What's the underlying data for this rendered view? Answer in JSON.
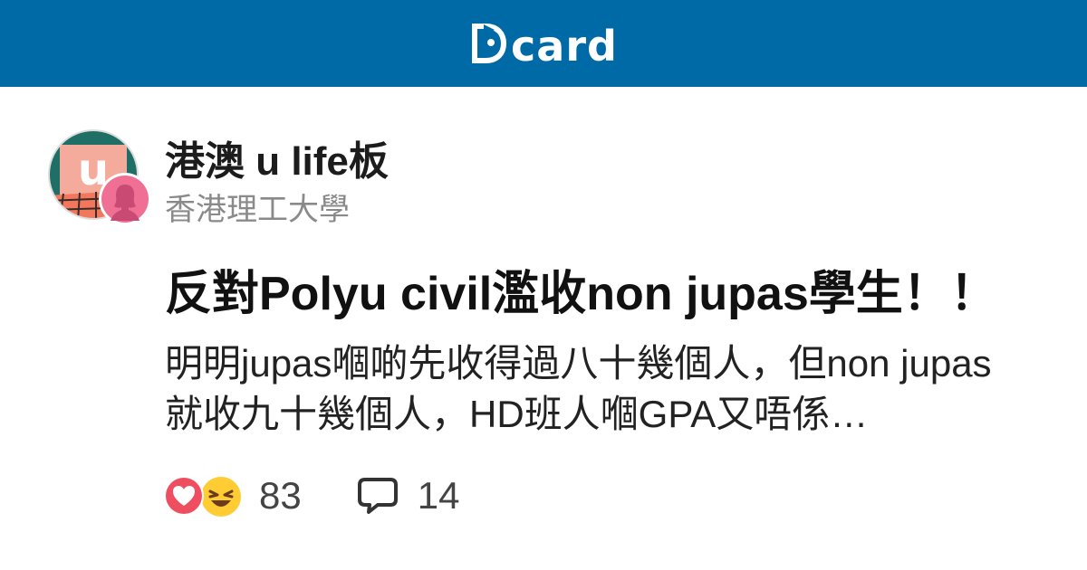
{
  "header": {
    "logo_text": "card",
    "background_color": "#006aa6"
  },
  "board": {
    "name": "港澳 u life板",
    "avatar_letter": "u",
    "avatar_icon": "board-avatar-icon"
  },
  "author": {
    "school": "香港理工大學",
    "avatar_icon": "female-avatar-icon"
  },
  "post": {
    "title": "反對Polyu civil濫收non jupas學生！！",
    "excerpt": "明明jupas嗰啲先收得過八十幾個人，但non jupas就收九十幾個人，HD班人嗰GPA又唔係…"
  },
  "stats": {
    "reaction_icons": [
      "heart-reaction-icon",
      "laugh-reaction-icon"
    ],
    "reaction_count": "83",
    "comment_icon": "comment-icon",
    "comment_count": "14"
  }
}
